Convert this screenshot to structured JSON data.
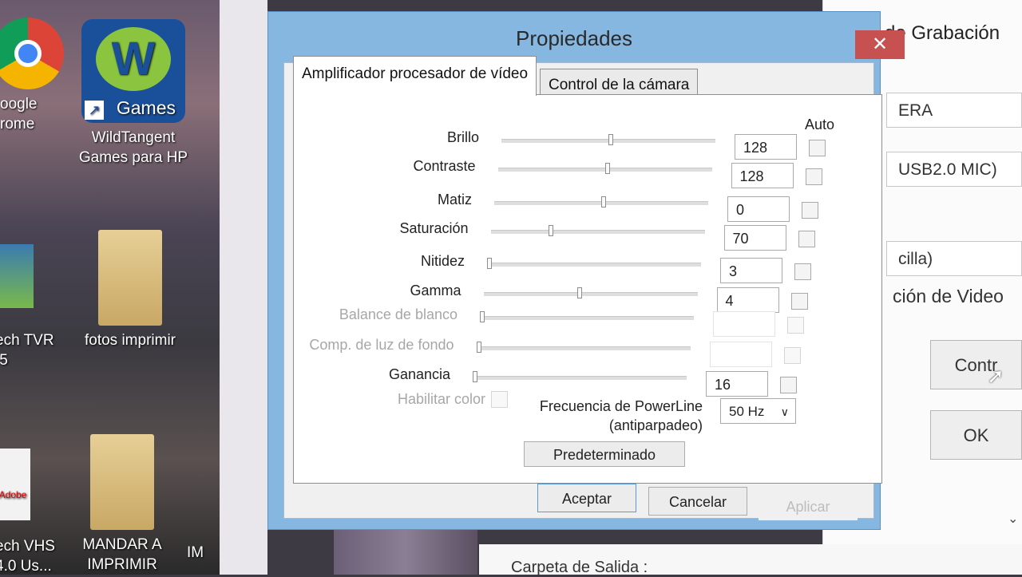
{
  "desktop": {
    "icons": [
      {
        "label": "oogle\nrome"
      },
      {
        "label": "WildTangent\nGames para HP",
        "badge": "Games"
      },
      {
        "label": "ech TVR\n.5"
      },
      {
        "label": "fotos imprimir"
      },
      {
        "label": "ech VHS\n4.0 Us..."
      },
      {
        "label": "MANDAR A\nIMPRIMIR"
      },
      {
        "label": "IM"
      }
    ],
    "pdf_badge": "Adobe"
  },
  "background_window": {
    "title": "de Grabación",
    "fields": [
      "ERA",
      "USB2.0 MIC)",
      "cilla)"
    ],
    "section": "ción de Video",
    "buttons": [
      "Contr",
      "OK"
    ],
    "bottom_label": "Carpeta de Salida :"
  },
  "dialog": {
    "title": "Propiedades",
    "close_glyph": "✕",
    "tabs": [
      "Amplificador procesador de vídeo",
      "Control de la cámara"
    ],
    "auto_header": "Auto",
    "rows": [
      {
        "label": "Brillo",
        "value": "128",
        "level": 0.5,
        "enabled": true
      },
      {
        "label": "Contraste",
        "value": "128",
        "level": 0.5,
        "enabled": true
      },
      {
        "label": "Matiz",
        "value": "0",
        "level": 0.5,
        "enabled": true
      },
      {
        "label": "Saturación",
        "value": "70",
        "level": 0.27,
        "enabled": true
      },
      {
        "label": "Nitidez",
        "value": "3",
        "level": 0.0,
        "enabled": true
      },
      {
        "label": "Gamma",
        "value": "4",
        "level": 0.44,
        "enabled": true
      },
      {
        "label": "Balance de blanco",
        "value": "",
        "level": 0.0,
        "enabled": false
      },
      {
        "label": "Comp. de luz de fondo",
        "value": "",
        "level": 0.0,
        "enabled": false
      },
      {
        "label": "Ganancia",
        "value": "16",
        "level": 0.0,
        "enabled": true
      }
    ],
    "habilitar_color": "Habilitar color",
    "powerline_label": "Frecuencia de PowerLine\n(antiparpadeo)",
    "powerline_value": "50 Hz",
    "predeterminado": "Predeterminado",
    "buttons": {
      "accept": "Aceptar",
      "cancel": "Cancelar",
      "apply": "Aplicar"
    }
  }
}
